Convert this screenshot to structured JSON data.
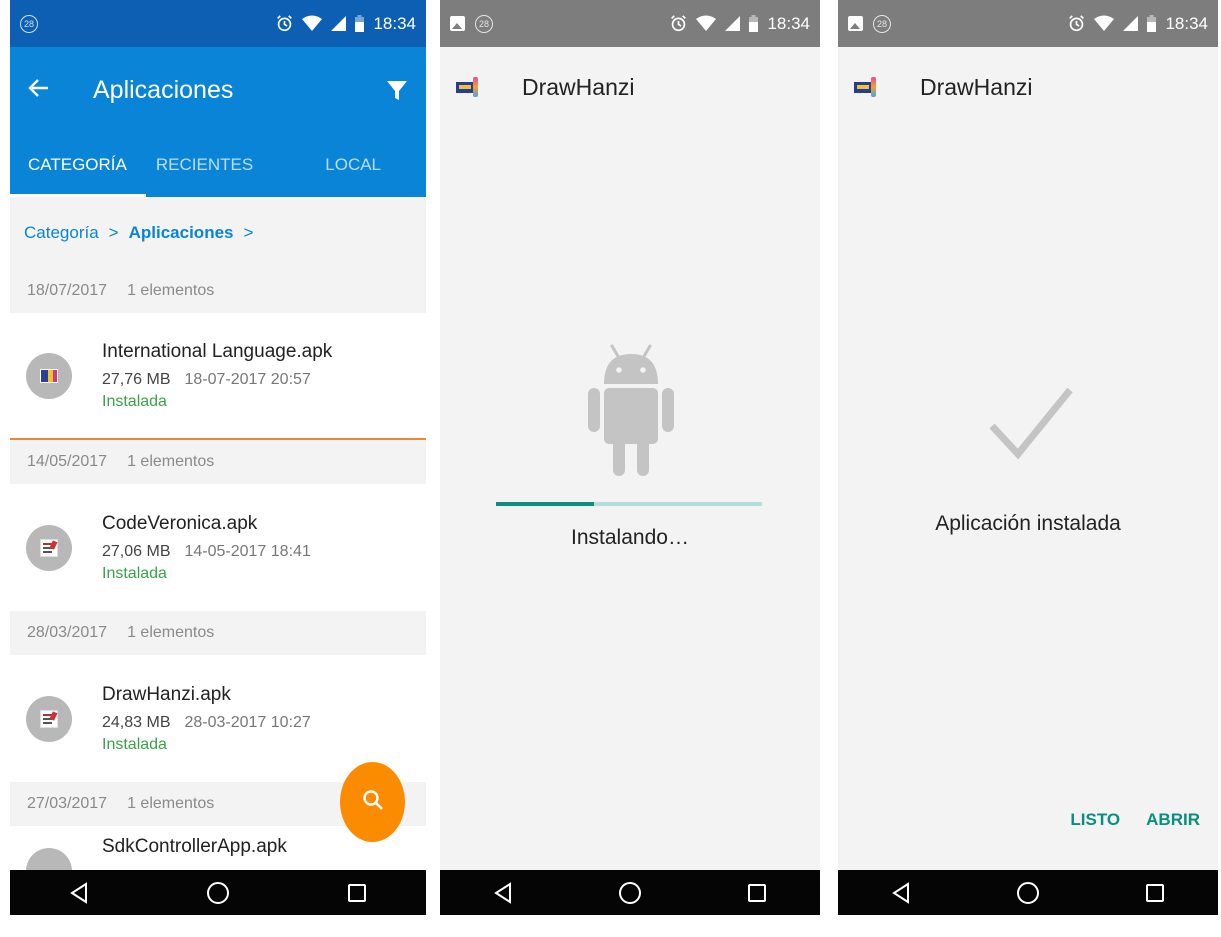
{
  "status_bar": {
    "time": "18:34",
    "badge": "28"
  },
  "files_app": {
    "title": "Aplicaciones",
    "tabs": [
      "CATEGORÍA",
      "RECIENTES",
      "LOCAL"
    ],
    "breadcrumb": {
      "first": "Categoría",
      "separator": ">",
      "current": "Aplicaciones",
      "trailing": ">"
    },
    "groups": [
      {
        "date": "18/07/2017",
        "count": "1 elementos",
        "file": {
          "name": "International Language.apk",
          "size": "27,76 MB",
          "modified": "18-07-2017 20:57",
          "status": "Instalada"
        }
      },
      {
        "date": "14/05/2017",
        "count": "1 elementos",
        "file": {
          "name": "CodeVeronica.apk",
          "size": "27,06 MB",
          "modified": "14-05-2017 18:41",
          "status": "Instalada"
        }
      },
      {
        "date": "28/03/2017",
        "count": "1 elementos",
        "file": {
          "name": "DrawHanzi.apk",
          "size": "24,83 MB",
          "modified": "28-03-2017 10:27",
          "status": "Instalada"
        }
      },
      {
        "date": "27/03/2017",
        "count": "1 elementos",
        "file": {
          "name": "SdkControllerApp.apk"
        }
      }
    ],
    "accent_color": "#0a84d6",
    "fab_color": "#fb8c00",
    "fab_icon": "search-icon"
  },
  "installer_installing": {
    "app_name": "DrawHanzi",
    "status": "Instalando…",
    "progress": 0.37
  },
  "installer_done": {
    "app_name": "DrawHanzi",
    "status": "Aplicación instalada",
    "done_label": "LISTO",
    "open_label": "ABRIR",
    "accent_color": "#0a8f7e"
  }
}
